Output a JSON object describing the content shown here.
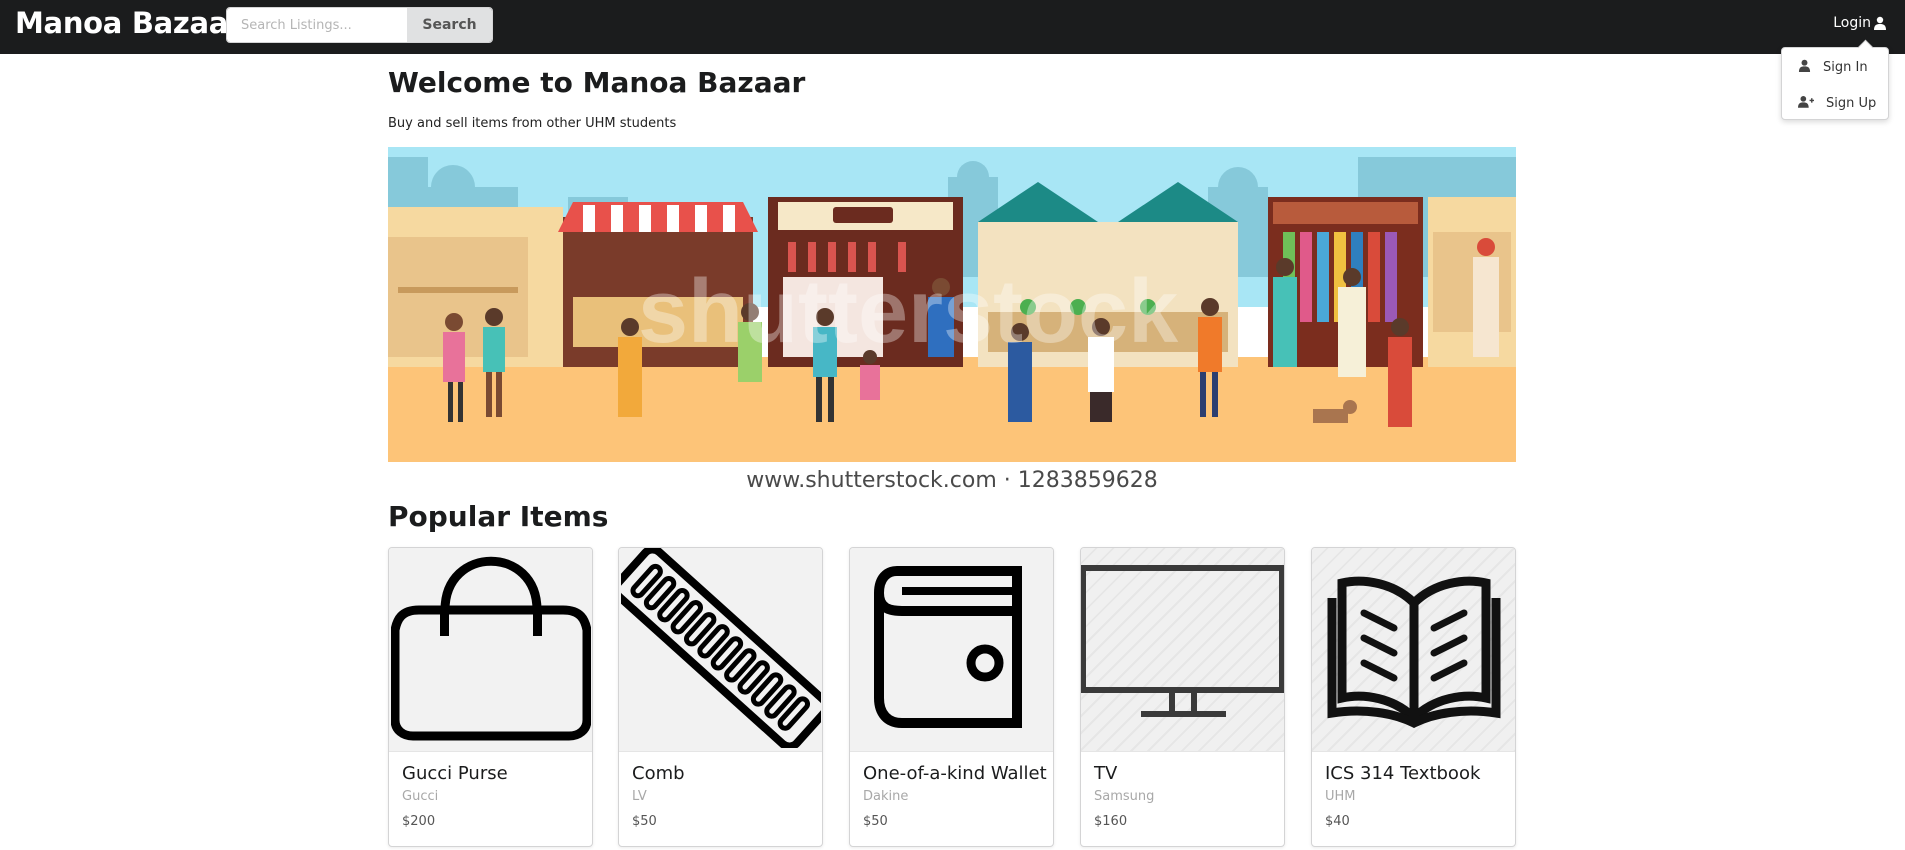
{
  "navbar": {
    "brand": "Manoa Bazaar",
    "search_placeholder": "Search Listings...",
    "search_button": "Search",
    "login_label": "Login"
  },
  "dropdown": {
    "items": [
      {
        "label": "Sign In",
        "icon": "user-icon"
      },
      {
        "label": "Sign Up",
        "icon": "user-plus-icon"
      }
    ]
  },
  "main": {
    "title": "Welcome to Manoa Bazaar",
    "subtitle": "Buy and sell items from other UHM students",
    "hero_caption": "www.shutterstock.com · 1283859628",
    "hero_watermark": "shutterstock",
    "section_title": "Popular Items"
  },
  "items": [
    {
      "name": "Gucci Purse",
      "brand": "Gucci",
      "price": "$200",
      "icon": "purse-icon"
    },
    {
      "name": "Comb",
      "brand": "LV",
      "price": "$50",
      "icon": "comb-icon"
    },
    {
      "name": "One-of-a-kind Wallet",
      "brand": "Dakine",
      "price": "$50",
      "icon": "wallet-icon"
    },
    {
      "name": "TV",
      "brand": "Samsung",
      "price": "$160",
      "icon": "tv-icon"
    },
    {
      "name": "ICS 314 Textbook",
      "brand": "UHM",
      "price": "$40",
      "icon": "book-icon"
    }
  ],
  "colors": {
    "navbar_bg": "#1b1c1d",
    "sky": "#a8e6f5",
    "ground": "#fdc478",
    "button_bg": "#e0e1e2"
  }
}
